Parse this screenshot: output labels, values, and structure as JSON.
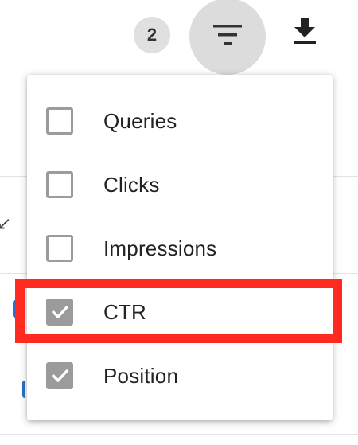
{
  "toolbar": {
    "selected_count": "2",
    "filter_icon": "filter-icon",
    "download_icon": "download-icon"
  },
  "menu": {
    "items": [
      {
        "label": "Queries",
        "checked": false
      },
      {
        "label": "Clicks",
        "checked": false
      },
      {
        "label": "Impressions",
        "checked": false
      },
      {
        "label": "CTR",
        "checked": true
      },
      {
        "label": "Position",
        "checked": true
      }
    ]
  },
  "annotation": {
    "highlight_color": "#ff2a1f",
    "highlighted_item": "CTR"
  },
  "colors": {
    "checkbox": "#9b9b9b",
    "filter_button_bg": "#dcdcdc",
    "badge_bg": "#e0e0e0",
    "link_accent": "#2a6fc9"
  }
}
